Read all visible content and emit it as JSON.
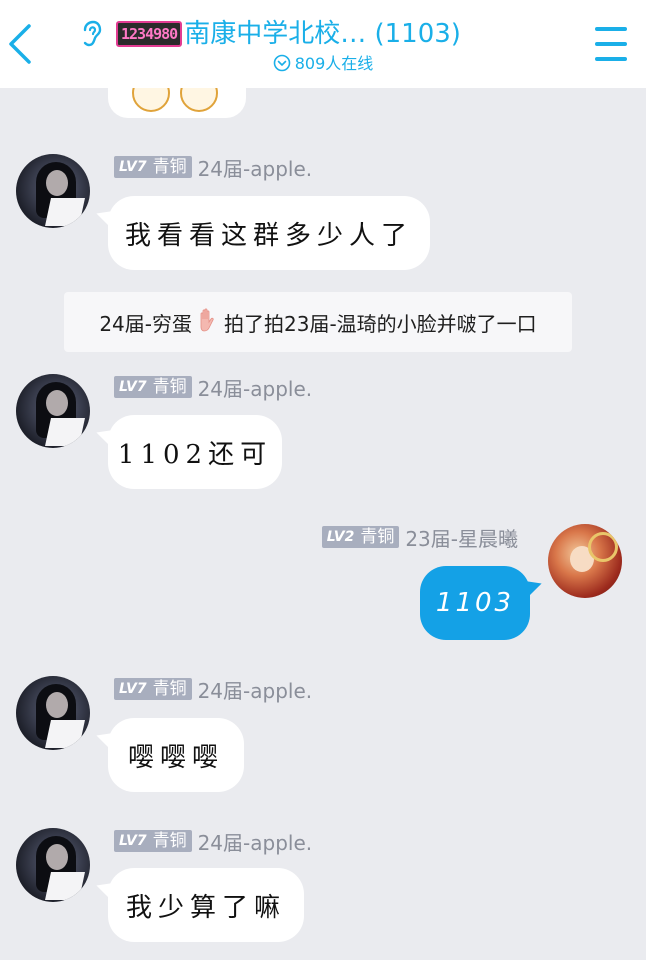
{
  "header": {
    "group_logo_text": "1234980",
    "group_name": "南康中学北校… (1103)",
    "online_text": "809人在线",
    "icons": [
      "back-chevron-icon",
      "ear-icon",
      "online-check-icon",
      "menu-icon"
    ],
    "accent_color": "#1AAFE8"
  },
  "badges": {
    "lv7_level": "LV7",
    "lv7_rank": "青铜",
    "lv2_level": "LV2",
    "lv2_rank": "青铜"
  },
  "messages": [
    {
      "sender": "24届-apple.",
      "text": "我看看这群多少人了",
      "side": "left"
    },
    {
      "sender": "24届-apple.",
      "text": "1102还可",
      "side": "left"
    },
    {
      "sender": "23届-星晨曦",
      "text": "1103",
      "side": "right"
    },
    {
      "sender": "24届-apple.",
      "text": "嘤嘤嘤",
      "side": "left"
    },
    {
      "sender": "24届-apple.",
      "text": "我少算了嘛",
      "side": "left"
    }
  ],
  "notice": {
    "before": "24届-穷蛋",
    "after": "拍了拍23届-温琦的小脸并啵了一口",
    "icon": "waving-hand-icon"
  },
  "colors": {
    "background": "#EAEBEF",
    "self_bubble": "#14A1E6",
    "badge": "#A8AEBE",
    "nickname": "#8A8E99"
  }
}
